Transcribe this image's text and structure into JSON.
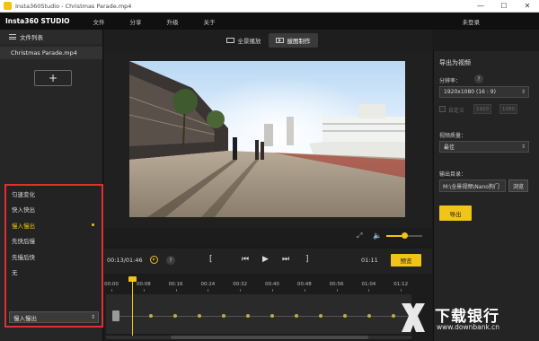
{
  "window": {
    "title": "Insta360Studio - Christmas Parade.mp4",
    "controls": {
      "minimize": "—",
      "maximize": "☐",
      "close": "✕"
    }
  },
  "menubar": {
    "brand": "Insta360 STUDIO",
    "items": [
      "文件",
      "分享",
      "升级",
      "关于"
    ],
    "login": "未登录"
  },
  "left_panel": {
    "header": "文件列表",
    "files": [
      "Christmas Parade.mp4"
    ],
    "add_label": "+",
    "speed_options": [
      "匀速变化",
      "快入快出",
      "慢入慢出",
      "先快后慢",
      "先慢后快",
      "无"
    ],
    "selected_index": 2,
    "speed_select_value": "慢入慢出",
    "caret": "⇕"
  },
  "mode_tabs": [
    {
      "label": "全景播放",
      "active": false
    },
    {
      "label": "拔图制作",
      "active": true
    }
  ],
  "view_controls": {
    "expand": "⤢",
    "volume_icon": "🔈",
    "volume_level": 0.5
  },
  "playback": {
    "current_time": "00:13/01:46",
    "help": "?",
    "bracket_left": "[",
    "prev": "⏮",
    "play": "▶",
    "next": "⏭",
    "bracket_right": "]",
    "total": "01:11",
    "preview_label": "预览"
  },
  "timeline": {
    "ticks": [
      "00:00",
      "00:08",
      "00:16",
      "00:24",
      "00:32",
      "00:40",
      "00:48",
      "00:56",
      "01:04",
      "01:12",
      "01:20",
      "01:28"
    ],
    "keyframes": 11
  },
  "right_panel": {
    "title": "导出为视频",
    "resolution_label": "分辨率：",
    "help": "?",
    "resolution_value": "1920x1080 (16 : 9)",
    "custom_label": "自定义",
    "dim_w": "1920",
    "dim_h": "1080",
    "quality_label": "视频质量：",
    "quality_value": "最佳",
    "output_label": "输出目录：",
    "output_path": "M:\\全景视频\\Nano狗门",
    "browse_label": "浏览",
    "export_label": "导出",
    "caret": "⇕"
  },
  "watermark": {
    "text": "下载银行",
    "url": "www.downbank.cn"
  }
}
